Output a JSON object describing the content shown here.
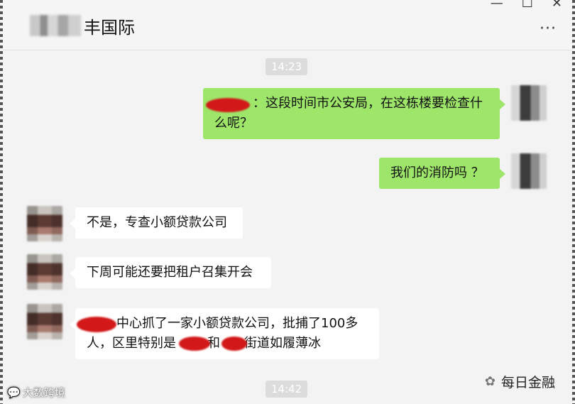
{
  "window": {
    "title": "丰国际",
    "controls": [
      "—",
      "☐",
      "✕"
    ],
    "more": "···"
  },
  "times": [
    "14:23",
    "14:42"
  ],
  "messages": [
    {
      "side": "me",
      "text": "：这段时间市公安局，在这栋楼要检查什么呢？"
    },
    {
      "side": "me",
      "text": "我们的消防吗 ？"
    },
    {
      "side": "them",
      "text": "不是，专查小额贷款公司"
    },
    {
      "side": "them",
      "text": "下周可能还要把租户召集开会"
    },
    {
      "side": "them",
      "line1": "中心抓了一家小额贷款公司，批捕了100多",
      "line2a": "人，区里特别是",
      "line2b": "和",
      "line2c": "街道如履薄冰"
    }
  ],
  "watermarks": {
    "left": "大数跨境",
    "right": "每日金融"
  }
}
